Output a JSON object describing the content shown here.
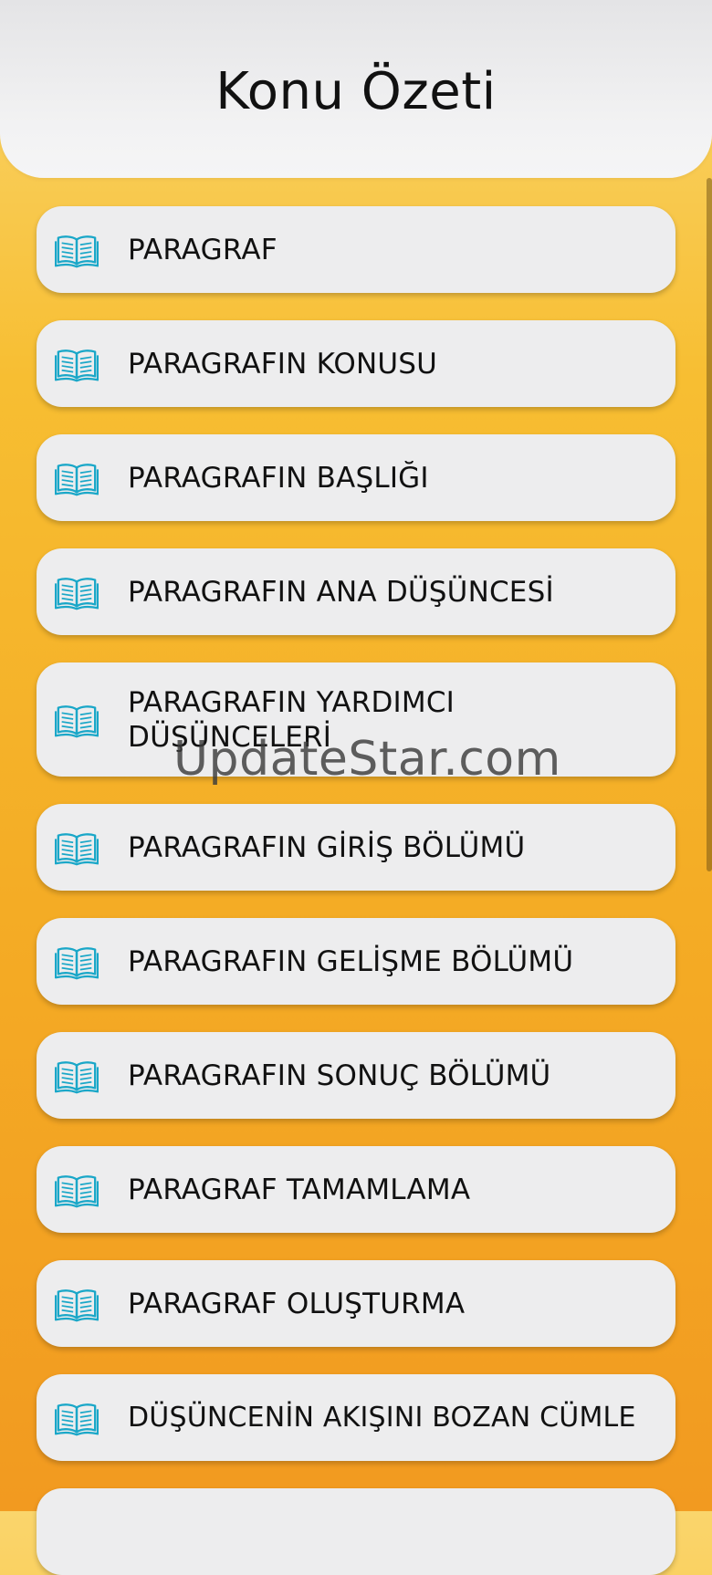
{
  "header": {
    "title": "Konu Özeti"
  },
  "icon_color": "#1aa7c8",
  "item_icon": "open-book-icon",
  "items": [
    {
      "label": "PARAGRAF"
    },
    {
      "label": "PARAGRAFIN KONUSU"
    },
    {
      "label": "PARAGRAFIN BAŞLIĞI"
    },
    {
      "label": "PARAGRAFIN ANA DÜŞÜNCESİ"
    },
    {
      "label": "PARAGRAFIN YARDIMCI DÜŞÜNCELERİ"
    },
    {
      "label": "PARAGRAFIN GİRİŞ BÖLÜMÜ"
    },
    {
      "label": "PARAGRAFIN GELİŞME BÖLÜMÜ"
    },
    {
      "label": "PARAGRAFIN SONUÇ BÖLÜMÜ"
    },
    {
      "label": "PARAGRAF TAMAMLAMA"
    },
    {
      "label": "PARAGRAF OLUŞTURMA"
    },
    {
      "label": "DÜŞÜNCENİN AKIŞINI BOZAN CÜMLE"
    },
    {
      "label": ""
    }
  ],
  "watermark": "UpdateStar.com"
}
